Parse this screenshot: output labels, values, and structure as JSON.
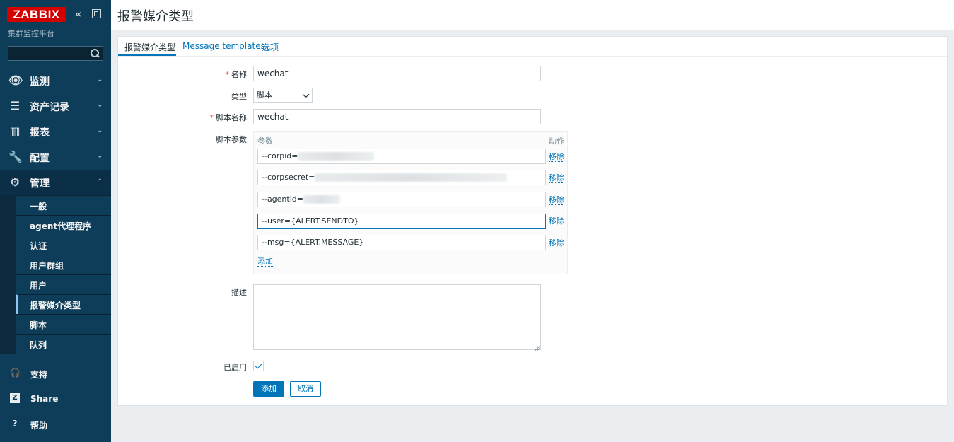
{
  "sidebar": {
    "logo": "ZABBIX",
    "server_name": "集群监控平台",
    "search_placeholder": "",
    "menu": [
      {
        "label": "监测",
        "icon": "eye-icon"
      },
      {
        "label": "资产记录",
        "icon": "list-icon"
      },
      {
        "label": "报表",
        "icon": "bar-chart-icon"
      },
      {
        "label": "配置",
        "icon": "wrench-icon"
      },
      {
        "label": "管理",
        "icon": "gear-icon"
      }
    ],
    "submenu": [
      "一般",
      "agent代理程序",
      "认证",
      "用户群组",
      "用户",
      "报警媒介类型",
      "脚本",
      "队列"
    ],
    "bottom": [
      {
        "label": "支持",
        "icon": "headset-icon"
      },
      {
        "label": "Share",
        "icon": "zabbix-share-icon"
      },
      {
        "label": "帮助",
        "icon": "help-icon"
      }
    ]
  },
  "page": {
    "title": "报警媒介类型"
  },
  "tabs": [
    "报警媒介类型",
    "Message templates",
    "选项"
  ],
  "form": {
    "name_label": "名称",
    "name_value": "wechat",
    "type_label": "类型",
    "type_value": "脚本",
    "script_name_label": "脚本名称",
    "script_name_value": "wechat",
    "params_label": "脚本参数",
    "params_header_param": "参数",
    "params_header_action": "动作",
    "params": [
      {
        "value": "--corpid="
      },
      {
        "value": "--corpsecret="
      },
      {
        "value": "--agentid="
      },
      {
        "value": "--user={ALERT.SENDTO}"
      },
      {
        "value": "--msg={ALERT.MESSAGE}"
      }
    ],
    "remove_label": "移除",
    "add_param_label": "添加",
    "description_label": "描述",
    "enabled_label": "已启用",
    "enabled": true,
    "submit_label": "添加",
    "cancel_label": "取消"
  },
  "colors": {
    "sidebar_bg": "#0e3d59",
    "accent": "#0275b8",
    "logo_red": "#d40000",
    "required": "#e45959"
  }
}
